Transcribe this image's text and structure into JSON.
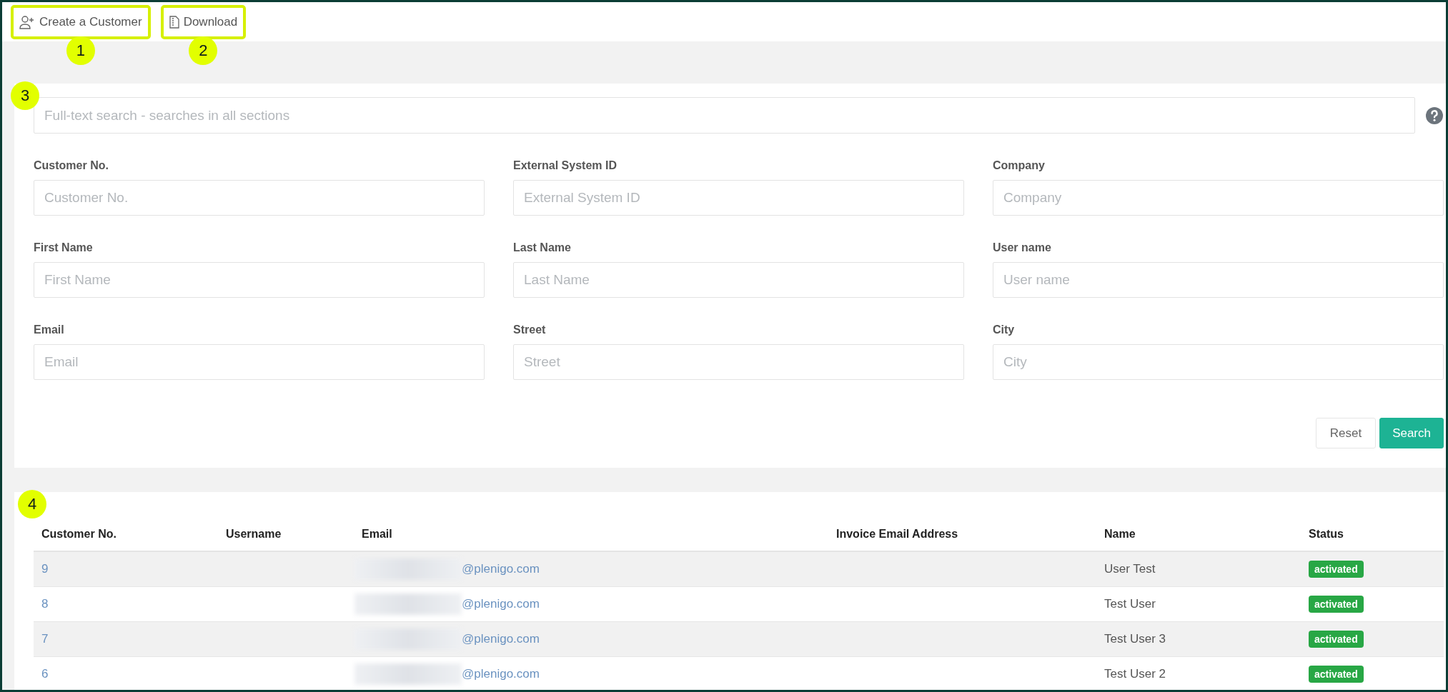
{
  "toolbar": [
    {
      "label": "Create a Customer",
      "kind": "add-user",
      "highlighted": true,
      "annotation": "1"
    },
    {
      "label": "Download",
      "kind": "file",
      "highlighted": true,
      "annotation": "2"
    }
  ],
  "filters": {
    "annotation": "3",
    "search": {
      "placeholder": "Full-text search - searches in all sections"
    },
    "fields": [
      {
        "label": "Customer No.",
        "placeholder": "Customer No."
      },
      {
        "label": "External System ID",
        "placeholder": "External System ID"
      },
      {
        "label": "Company",
        "placeholder": "Company"
      },
      {
        "label": "First Name",
        "placeholder": "First Name"
      },
      {
        "label": "Last Name",
        "placeholder": "Last Name"
      },
      {
        "label": "User name",
        "placeholder": "User name"
      },
      {
        "label": "Email",
        "placeholder": "Email"
      },
      {
        "label": "Street",
        "placeholder": "Street"
      },
      {
        "label": "City",
        "placeholder": "City"
      }
    ],
    "buttons": [
      {
        "label": "Reset",
        "kind": "secondary"
      },
      {
        "label": "Search",
        "kind": "primary"
      }
    ]
  },
  "table": {
    "annotation": "4",
    "columns": [
      "Customer No.",
      "Username",
      "Email",
      "Invoice Email Address",
      "Name",
      "Status"
    ],
    "rows": [
      {
        "customer_no": "9",
        "email": "@plenigo.com",
        "email_redacted": true,
        "name": "User Test",
        "status": "activated"
      },
      {
        "customer_no": "8",
        "email": "@plenigo.com",
        "email_redacted": true,
        "name": "Test User",
        "status": "activated"
      },
      {
        "customer_no": "7",
        "email": "@plenigo.com",
        "email_redacted": true,
        "name": "Test User 3",
        "status": "activated"
      },
      {
        "customer_no": "6",
        "email": "@plenigo.com",
        "email_redacted": true,
        "name": "Test User 2",
        "status": "activated"
      }
    ]
  }
}
